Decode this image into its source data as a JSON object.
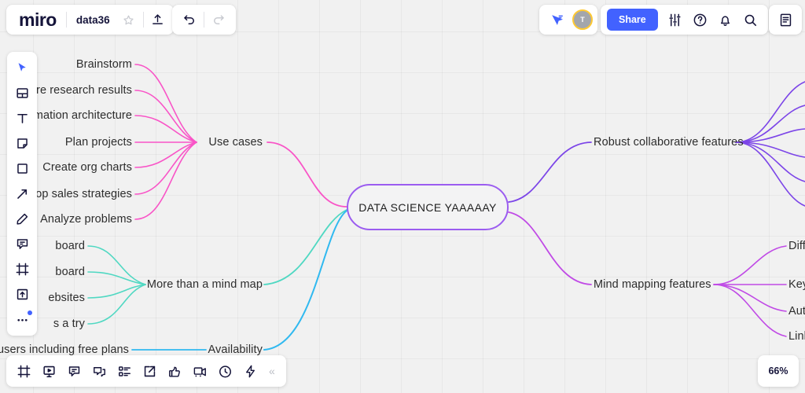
{
  "app": {
    "logo": "miro",
    "zoom_level": "66%"
  },
  "header": {
    "board_name": "data36",
    "star_icon": "star-icon",
    "upload_icon": "upload-icon",
    "undo_icon": "undo-icon",
    "redo_icon": "redo-icon",
    "presence_icon": "cursor-presence-icon",
    "avatar_initial": "T",
    "avatar_ring_color": "#ffc933",
    "share_label": "Share",
    "share_color": "#4262ff",
    "sliders_icon": "sliders-icon",
    "help_icon": "help-circle-icon",
    "bell_icon": "bell-icon",
    "search_icon": "search-icon",
    "notes_icon": "notes-panel-icon"
  },
  "toolbar_left": {
    "items": [
      {
        "name": "select-tool",
        "icon": "cursor-icon",
        "selected": true
      },
      {
        "name": "templates-tool",
        "icon": "templates-icon",
        "selected": false
      },
      {
        "name": "text-tool",
        "icon": "text-icon",
        "selected": false
      },
      {
        "name": "sticky-note-tool",
        "icon": "sticky-note-icon",
        "selected": false
      },
      {
        "name": "shape-tool",
        "icon": "square-icon",
        "selected": false
      },
      {
        "name": "connector-tool",
        "icon": "arrow-icon",
        "selected": false
      },
      {
        "name": "pen-tool",
        "icon": "pen-icon",
        "selected": false
      },
      {
        "name": "comment-tool",
        "icon": "comment-icon",
        "selected": false
      },
      {
        "name": "frame-tool",
        "icon": "frame-icon",
        "selected": false
      },
      {
        "name": "upload-tool",
        "icon": "upload-box-icon",
        "selected": false
      },
      {
        "name": "more-tool",
        "icon": "more-dots-icon",
        "selected": false,
        "badge": true
      }
    ]
  },
  "toolbar_bottom": {
    "items": [
      {
        "name": "frames-button",
        "icon": "frame-icon"
      },
      {
        "name": "presentation-button",
        "icon": "presentation-icon"
      },
      {
        "name": "comments-button",
        "icon": "comment-icon"
      },
      {
        "name": "chat-button",
        "icon": "chat-icon"
      },
      {
        "name": "cards-button",
        "icon": "cards-icon"
      },
      {
        "name": "export-button",
        "icon": "export-icon"
      },
      {
        "name": "voting-button",
        "icon": "thumbs-up-icon"
      },
      {
        "name": "video-chat-button",
        "icon": "video-icon"
      },
      {
        "name": "timer-button",
        "icon": "timer-icon"
      },
      {
        "name": "actions-button",
        "icon": "lightning-icon"
      }
    ],
    "collapse_label": "«"
  },
  "mindmap": {
    "central": {
      "label": "DATA SCIENCE YAAAAAY",
      "color": "#9b5cf0"
    },
    "branches": [
      {
        "name": "use-cases",
        "label": "Use cases",
        "color": "#f954c7",
        "side": "left",
        "children": [
          "Brainstorm",
          "ure research results",
          "mation architecture",
          "Plan projects",
          "Create org charts",
          "elop sales strategies",
          "Analyze problems"
        ]
      },
      {
        "name": "more-than-a-mind-map",
        "label": "More than a mind map",
        "color": "#4fd8c2",
        "side": "left",
        "children": [
          "board",
          "board",
          "ebsites",
          "s a try"
        ]
      },
      {
        "name": "availability",
        "label": "Availability",
        "color": "#30b9f0",
        "side": "left",
        "children": [
          "l users including free plans"
        ]
      },
      {
        "name": "robust-collaborative-features",
        "label": "Robust collaborative features",
        "color": "#7c45e8",
        "side": "right",
        "children": [
          "",
          "",
          "",
          "",
          "",
          ""
        ]
      },
      {
        "name": "mind-mapping-features",
        "label": "Mind mapping features",
        "color": "#c04ae6",
        "side": "right",
        "children": [
          "Diff",
          "Key",
          "Aut",
          "Linl"
        ]
      }
    ]
  }
}
